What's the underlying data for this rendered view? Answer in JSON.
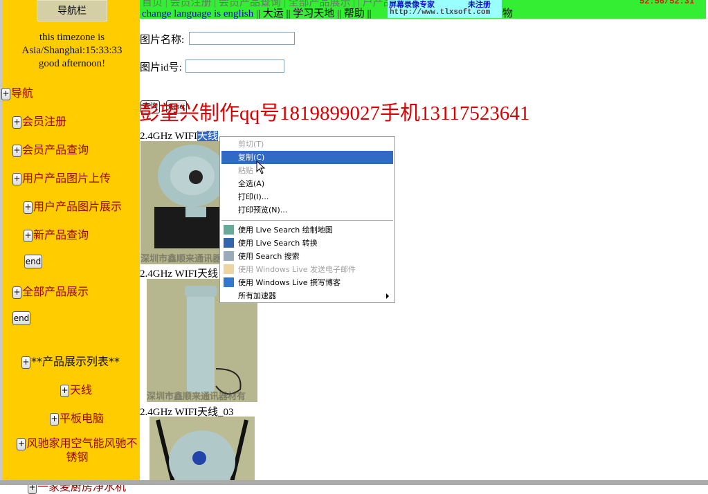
{
  "sidebar": {
    "header": "导航栏",
    "timezone_line1": "this timezone is",
    "timezone_line2": "Asia/Shanghai:15:33:33",
    "greeting": "good afternoon!",
    "items": [
      {
        "label": "导航"
      },
      {
        "label": "会员注册"
      },
      {
        "label": "会员产品查询"
      },
      {
        "label": "用户产品图片上传"
      },
      {
        "label": "用户产品图片展示"
      },
      {
        "label": "新产品查询"
      },
      {
        "label": "end"
      },
      {
        "label": "全部产品展示"
      },
      {
        "label": "end"
      },
      {
        "label": "**产品展示列表**"
      },
      {
        "label": "天线"
      },
      {
        "label": "平板电脑"
      },
      {
        "label": "风驰家用空气能风驰不锈钢"
      },
      {
        "label": "一家麦厨房净水机"
      }
    ],
    "plus_symbol": "+"
  },
  "topnav": {
    "row1": "首页 | 会员注册 | 会员产品查询 | 全部产品展示 |                                        | 户产品图片展示 | 用户产品",
    "row2": [
      "change language is english",
      "大运",
      "学习天地",
      "帮助",
      "物"
    ],
    "separator": "||",
    "overlay_title": "屏幕录像专家",
    "overlay_status": "未注册",
    "overlay_url": "http://www.tlxsoft.com",
    "clock": "52:56/52:31"
  },
  "form": {
    "name_label": "图片名称:",
    "name_value": "",
    "id_label": "图片id号:",
    "id_value": "",
    "query_button": "查询",
    "reset_button": "Reset"
  },
  "banner": "彭望兴制作qq号1819899027手机13117523641",
  "products": [
    {
      "caption_prefix": "2.4GHz WIFI",
      "caption_selected": "天线",
      "watermark": "深圳市鑫顺来通讯器材有"
    },
    {
      "caption": "2.4GHz WIFI天线",
      "watermark": "深圳市鑫顺来通讯器材有"
    },
    {
      "caption": "2.4GHz WIFI天线_03"
    }
  ],
  "context_menu": {
    "items": [
      {
        "label": "剪切(T)",
        "disabled": true
      },
      {
        "label": "复制(C)",
        "highlighted": true
      },
      {
        "label": "粘贴",
        "disabled": true
      },
      {
        "label": "全选(A)"
      },
      {
        "label": "打印(I)..."
      },
      {
        "label": "打印预览(N)..."
      },
      {
        "label": "使用 Live Search 绘制地图",
        "icon": "map-icon"
      },
      {
        "label": "使用 Live Search 转换",
        "icon": "translate-icon"
      },
      {
        "label": "使用 Search 搜索",
        "icon": "search-icon"
      },
      {
        "label": "使用 Windows Live 发送电子邮件",
        "icon": "email-icon",
        "disabled": true
      },
      {
        "label": "使用 Windows Live 撰写博客",
        "icon": "blog-icon"
      },
      {
        "label": "所有加速器",
        "submenu": true
      }
    ],
    "highlight_color": "#316AC5"
  },
  "colors": {
    "sidebar": "#FFCC00",
    "topbar": "#33EE33",
    "banner": "#D80000",
    "link": "#990000"
  }
}
